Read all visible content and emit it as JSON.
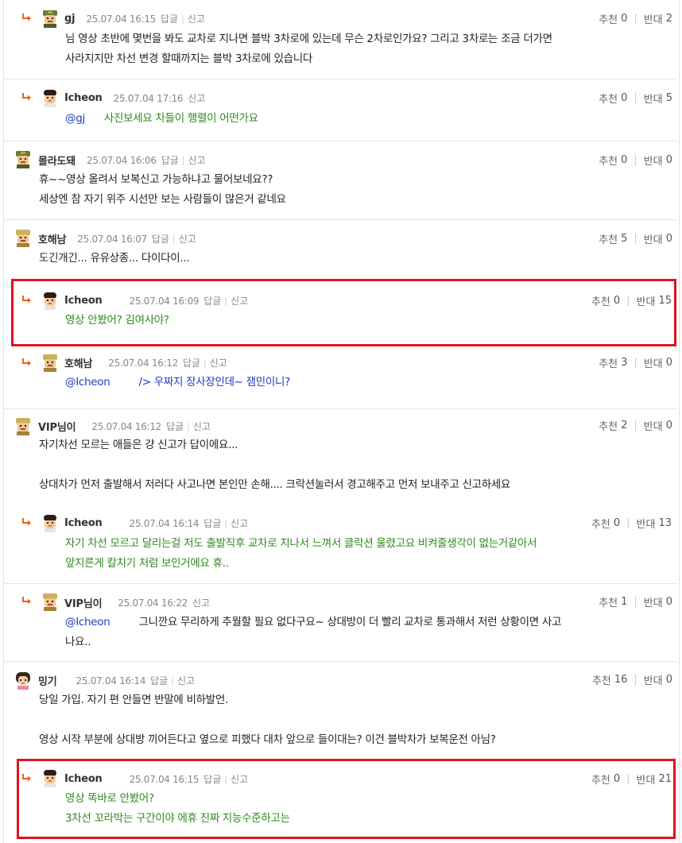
{
  "labels": {
    "reply": "답글",
    "report": "신고",
    "up": "추천",
    "down": "반대"
  },
  "comments": [
    {
      "nick": "gj",
      "date": "25.07.04 16:15",
      "up": "0",
      "down": "2",
      "lines": [
        "님 영상 초반에 몇번을 봐도 교차로 지나면 블박 3차로에 있는데 무슨 2차로인가요? 그리고 3차로는 조금 더가면",
        "사라지지만 차선 변경 할때까지는 블박 3차로에 있습니다"
      ]
    },
    {
      "nick": "Icheon",
      "date": "25.07.04 17:16",
      "up": "0",
      "down": "5",
      "mention": "@gj",
      "lines": [
        "사진보세요 차들이 행렬이 어떤가요"
      ]
    },
    {
      "nick": "몰라도돼",
      "date": "25.07.04 16:06",
      "up": "0",
      "down": "0",
      "lines": [
        "휴~~영상 올려서 보복신고 가능하냐고 물어보네요??",
        "세상엔 참 자기 위주 시선만 보는 사람들이 많은거 같네요"
      ]
    },
    {
      "nick": "호해남",
      "date": "25.07.04 16:07",
      "up": "5",
      "down": "0",
      "lines": [
        "도긴개긴... 유유상종... 다이다이..."
      ]
    },
    {
      "nick": "Icheon",
      "date": "25.07.04 16:09",
      "up": "0",
      "down": "15",
      "lines": [
        "영상 안봤어? 김여사야?"
      ]
    },
    {
      "nick": "호해남",
      "date": "25.07.04 16:12",
      "up": "3",
      "down": "0",
      "mention": "@Icheon",
      "lines": [
        "/> 우짜지 장사장인데~ 잼민이니?"
      ]
    },
    {
      "nick": "VIP님이",
      "date": "25.07.04 16:12",
      "up": "2",
      "down": "0",
      "lines": [
        "자기차선 모르는 애들은 걍 신고가 답이에요...",
        "",
        "상대차가 먼저 출발해서 저러다 사고나면 본인만 손해.... 크락션눌러서 경고해주고 먼저 보내주고 신고하세요"
      ]
    },
    {
      "nick": "Icheon",
      "date": "25.07.04 16:14",
      "up": "0",
      "down": "13",
      "lines": [
        "자기 차선 모르고 달리는걸 저도 출발직후 교차로 지나서 느껴서 클락션 울렸고요 비켜줄생각이 없는거같아서",
        "앞지른게 칼치기 처럼 보인거에요 휴.."
      ]
    },
    {
      "nick": "VIP님이",
      "date": "25.07.04 16:22",
      "up": "1",
      "down": "0",
      "mention": "@Icheon",
      "lines": [
        "그니깐요 무리하게 추월할 필요 없다구요~ 상대방이 더 빨리 교차로 통과해서 저런 상황이면 사고",
        "나요.."
      ]
    },
    {
      "nick": "밍기",
      "date": "25.07.04 16:14",
      "up": "16",
      "down": "0",
      "lines": [
        "당일 가입. 자기 편 안들면 반말에 비하발언.",
        "",
        "영상 시작 부분에 상대방 끼어든다고 옆으로 피했다 대차 앞으로 들이대는? 이건 블박차가 보복운전 아님?"
      ]
    },
    {
      "nick": "Icheon",
      "date": "25.07.04 16:15",
      "up": "0",
      "down": "21",
      "lines": [
        "영상 똑바로 안봤어?",
        "3차선 꼬라박는 구간이야 에휴 진짜 지능수준하고는"
      ]
    }
  ]
}
